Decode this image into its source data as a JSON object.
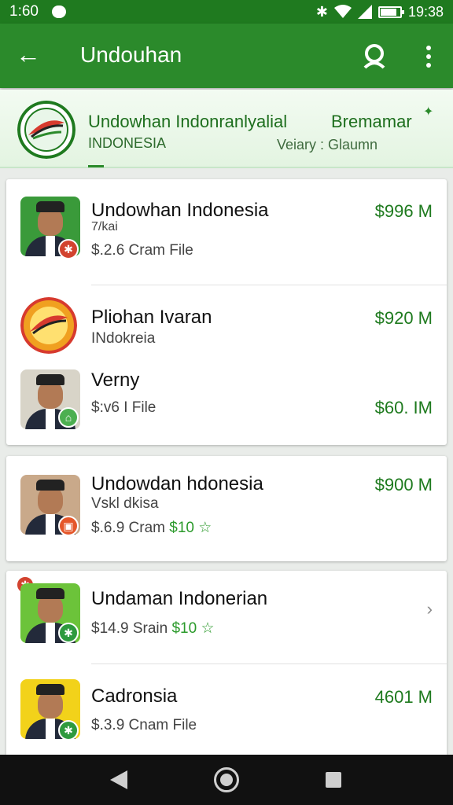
{
  "status_bar": {
    "time": "1:60",
    "clock": "19:38",
    "battery_level": 0.85
  },
  "app_bar": {
    "title": "Undouhan",
    "back_icon": "arrow-left-icon",
    "search_icon": "search-icon",
    "menu_icon": "more-vert-icon"
  },
  "banner": {
    "title_left": "Undowhan Indonranlyalial",
    "title_right": "Bremamar",
    "subtitle_left": "INDONESIA",
    "subtitle_right": "Veiary : Glaumn"
  },
  "items": [
    {
      "name": "Undowhan Indonesia",
      "line1": "7/kai",
      "line2": "$.2.6 Cram File",
      "price": "$996 M",
      "badge_color": "#d2432f"
    },
    {
      "name": "Pliohan Ivaran",
      "line1": "INdokreia",
      "price": "$920 M"
    },
    {
      "name": "Verny",
      "line2": "$:v6 I File",
      "price": "$60. IM",
      "badge_color": "#4caf50"
    },
    {
      "name": "Undowdan hdonesia",
      "line1": "Vskl dkisa",
      "line2": "$.6.9 Cram",
      "line2_extra": "$10",
      "price": "$900 M",
      "badge_color": "#e5572a"
    },
    {
      "name": "Undaman Indonerian",
      "line2": "$14.9 Srain",
      "line2_extra": "$10",
      "badge_color": "#2e9a3e"
    },
    {
      "name": "Cadronsia",
      "line2": "$.3.9 Cnam File",
      "price": "4601 M",
      "badge_color": "#2e9a3e"
    }
  ],
  "colors": {
    "primary": "#2b8a2b",
    "status_bar": "#1f7a1f",
    "price": "#1e7a1e"
  },
  "nav": {
    "back": "nav-back-icon",
    "home": "nav-home-icon",
    "recents": "nav-recents-icon"
  }
}
